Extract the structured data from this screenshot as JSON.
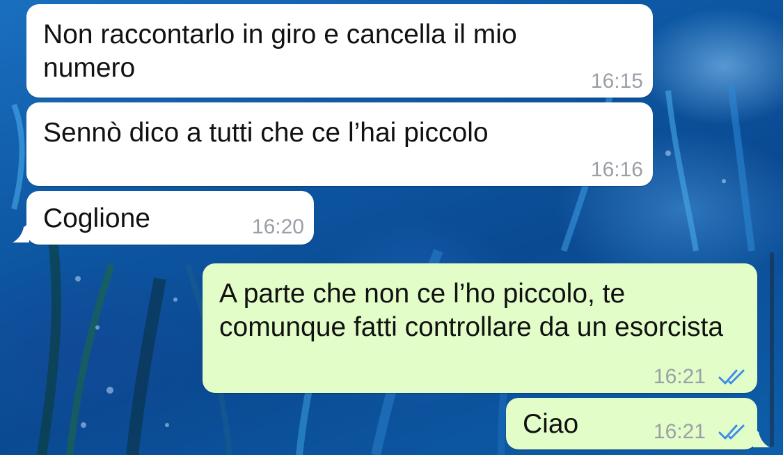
{
  "messages": [
    {
      "direction": "incoming",
      "text": "Non raccontarlo in giro e cancella il mio numero",
      "time": "16:15"
    },
    {
      "direction": "incoming",
      "text": "Sennò dico a tutti che ce l’hai piccolo",
      "time": "16:16"
    },
    {
      "direction": "incoming",
      "text": "Coglione",
      "time": "16:20"
    },
    {
      "direction": "outgoing",
      "text": "A parte che non ce l’ho piccolo, te comunque fatti controllare da un esorcista",
      "time": "16:21",
      "status_icon": "double-check-read-icon"
    },
    {
      "direction": "outgoing",
      "text": "Ciao",
      "time": "16:21",
      "status_icon": "double-check-read-icon"
    }
  ],
  "colors": {
    "incoming_bubble": "#ffffff",
    "outgoing_bubble": "#e2fdc8",
    "timestamp": "#9aa0a6",
    "read_ticks": "#3b8de8"
  },
  "wallpaper_icon": "blue-grass-dew-wallpaper"
}
